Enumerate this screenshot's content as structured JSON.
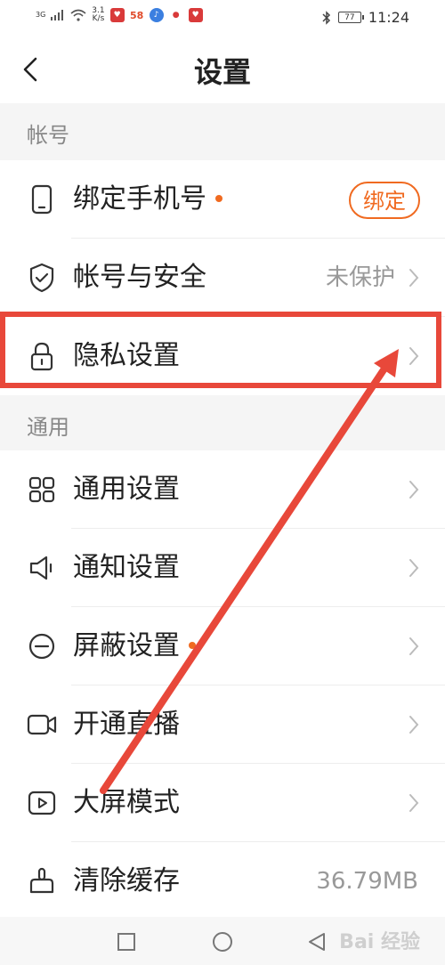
{
  "status_bar": {
    "signal": "3G",
    "speed_value": "3.1",
    "speed_unit": "K/s",
    "app_58": "58",
    "battery": "77",
    "time": "11:24"
  },
  "header": {
    "title": "设置"
  },
  "sections": {
    "account": {
      "title": "帐号",
      "items": [
        {
          "label": "绑定手机号",
          "action_label": "绑定"
        },
        {
          "label": "帐号与安全",
          "value": "未保护"
        },
        {
          "label": "隐私设置"
        }
      ]
    },
    "general": {
      "title": "通用",
      "items": [
        {
          "label": "通用设置"
        },
        {
          "label": "通知设置"
        },
        {
          "label": "屏蔽设置"
        },
        {
          "label": "开通直播"
        },
        {
          "label": "大屏模式"
        },
        {
          "label": "清除缓存",
          "value": "36.79MB"
        }
      ]
    }
  },
  "watermark": "Bai 经验",
  "colors": {
    "accent": "#f06a20",
    "annotation": "#e8483a",
    "section_bg": "#f5f5f5"
  }
}
